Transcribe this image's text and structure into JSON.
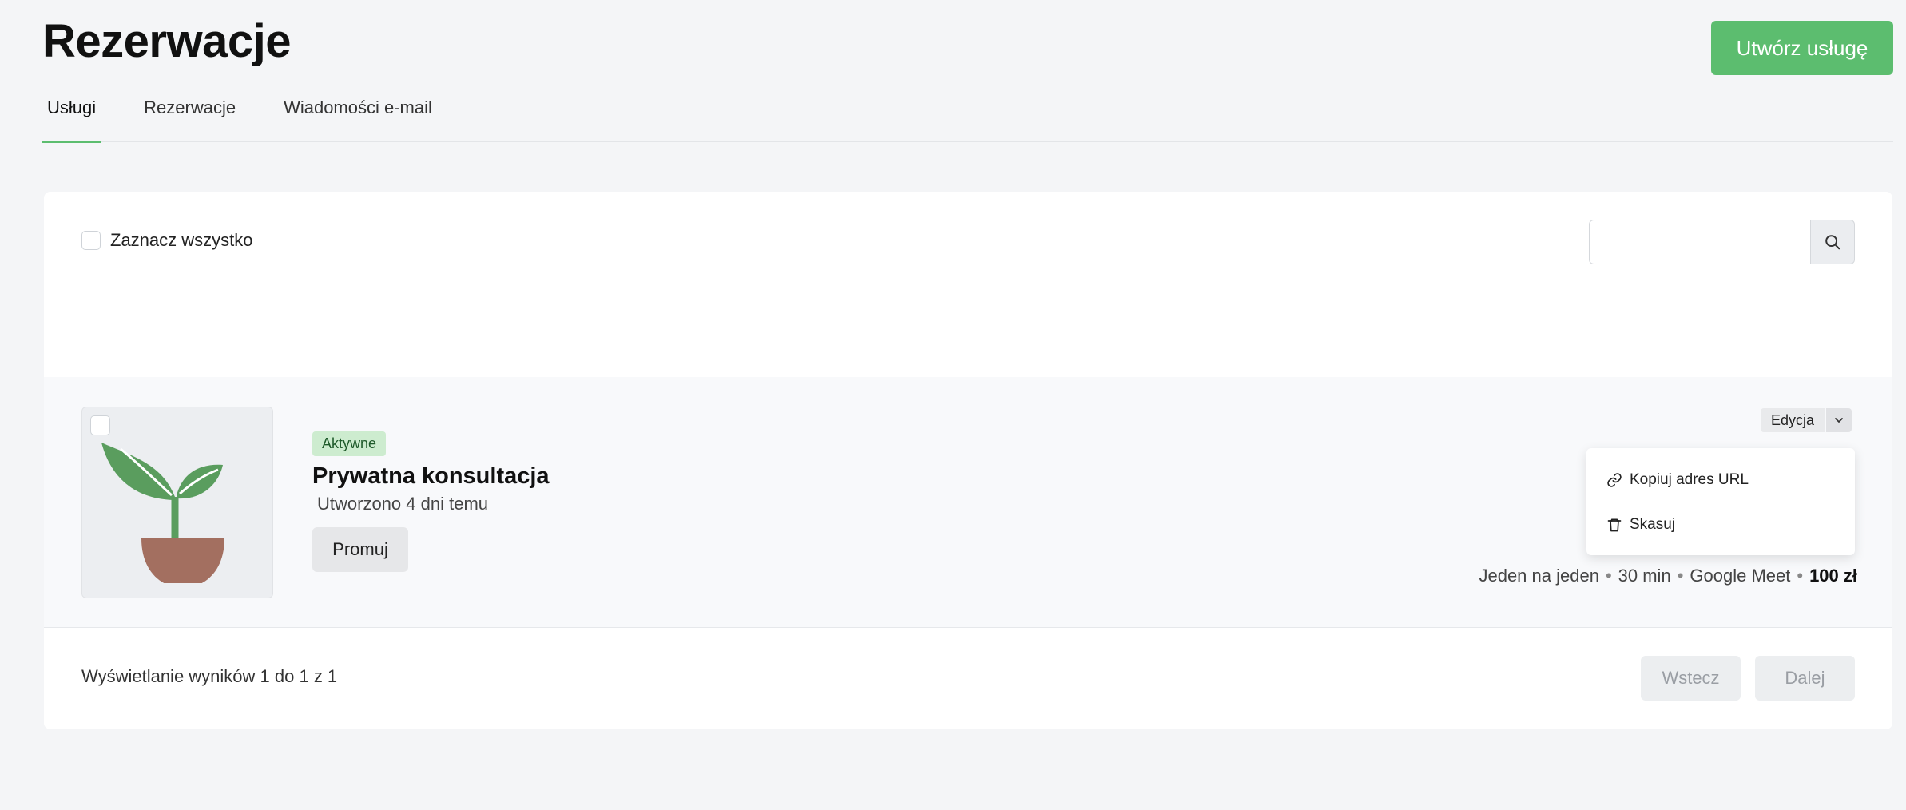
{
  "header": {
    "title": "Rezerwacje",
    "create_button": "Utwórz usługę"
  },
  "tabs": [
    {
      "label": "Usługi",
      "active": true
    },
    {
      "label": "Rezerwacje",
      "active": false
    },
    {
      "label": "Wiadomości e-mail",
      "active": false
    }
  ],
  "toolbar": {
    "select_all_label": "Zaznacz wszystko",
    "search_value": "",
    "search_icon": "search-icon"
  },
  "service": {
    "status_badge": "Aktywne",
    "title": "Prywatna konsultacja",
    "created_prefix": "Utworzono",
    "created_ago": "4 dni temu",
    "promote_button": "Promuj",
    "edit_button": "Edycja",
    "menu": {
      "copy_url": "Kopiuj adres URL",
      "delete": "Skasuj"
    },
    "meta": {
      "type": "Jeden na jeden",
      "duration": "30 min",
      "location": "Google Meet",
      "price": "100 zł"
    }
  },
  "footer": {
    "results_text": "Wyświetlanie wyników 1 do 1 z 1",
    "prev_button": "Wstecz",
    "next_button": "Dalej"
  },
  "colors": {
    "accent": "#5cbd6f",
    "badge_bg": "#cdeccf",
    "leaf": "#5a9d5e",
    "pot": "#a36f60"
  }
}
